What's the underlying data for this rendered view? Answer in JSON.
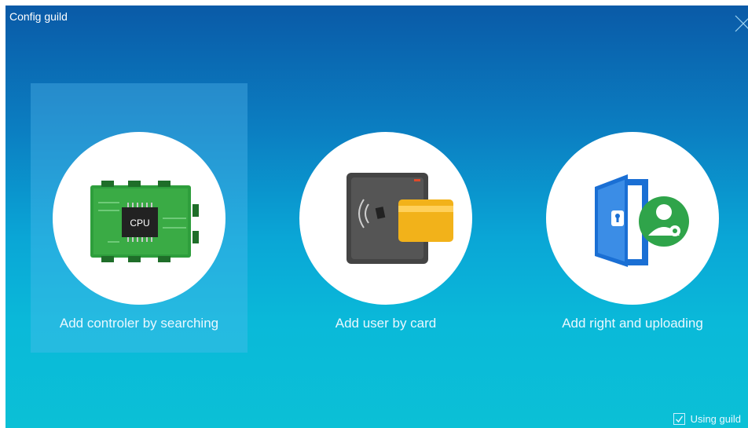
{
  "window": {
    "title": "Config guild"
  },
  "options": [
    {
      "label": "Add controler by searching",
      "icon": "cpu-board-icon",
      "selected": true
    },
    {
      "label": "Add user by card",
      "icon": "card-reader-icon",
      "selected": false
    },
    {
      "label": "Add right and uploading",
      "icon": "door-user-settings-icon",
      "selected": false
    }
  ],
  "cpu_chip_text": "CPU",
  "footer": {
    "checkbox_label": "Using guild",
    "checked": true
  },
  "colors": {
    "gradient_top": "#0a5aa7",
    "gradient_bottom": "#0bc0d6",
    "board_green": "#2e9e3c",
    "card_yellow": "#f2b21a",
    "door_blue": "#1a6fd4",
    "badge_green": "#2fa44a"
  }
}
